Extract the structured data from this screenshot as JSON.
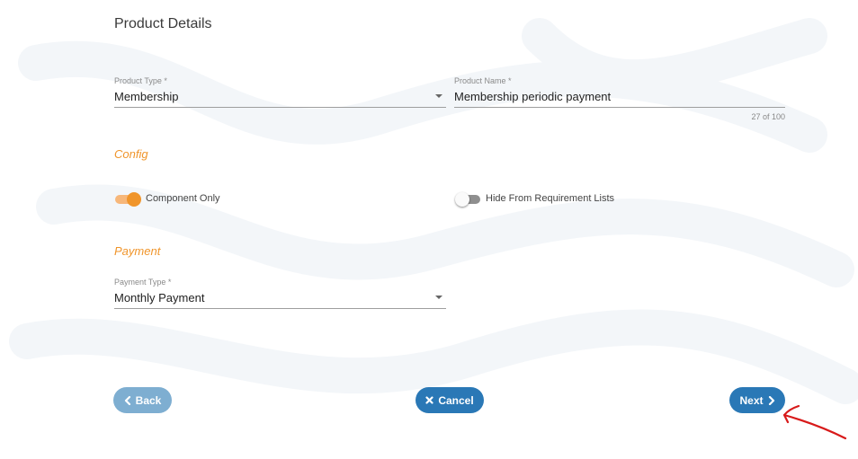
{
  "page_title": "Product Details",
  "product_type": {
    "label": "Product Type *",
    "value": "Membership"
  },
  "product_name": {
    "label": "Product Name *",
    "value": "Membership periodic payment",
    "counter": "27 of 100"
  },
  "config": {
    "title": "Config",
    "component_only": {
      "label": "Component Only",
      "on": true
    },
    "hide_from_requirement_lists": {
      "label": "Hide From Requirement Lists",
      "on": false
    }
  },
  "payment": {
    "title": "Payment",
    "payment_type": {
      "label": "Payment Type *",
      "value": "Monthly Payment"
    }
  },
  "buttons": {
    "back": "Back",
    "cancel": "Cancel",
    "next": "Next"
  },
  "colors": {
    "accent_orange": "#f0952b",
    "button_blue": "#2a78b6",
    "button_blue_light": "#7eaed1",
    "annotation_red": "#d81a1a"
  },
  "icons": {
    "back": "chevron-left-icon",
    "cancel": "close-icon",
    "next": "chevron-right-icon",
    "dropdown": "caret-down-icon"
  }
}
